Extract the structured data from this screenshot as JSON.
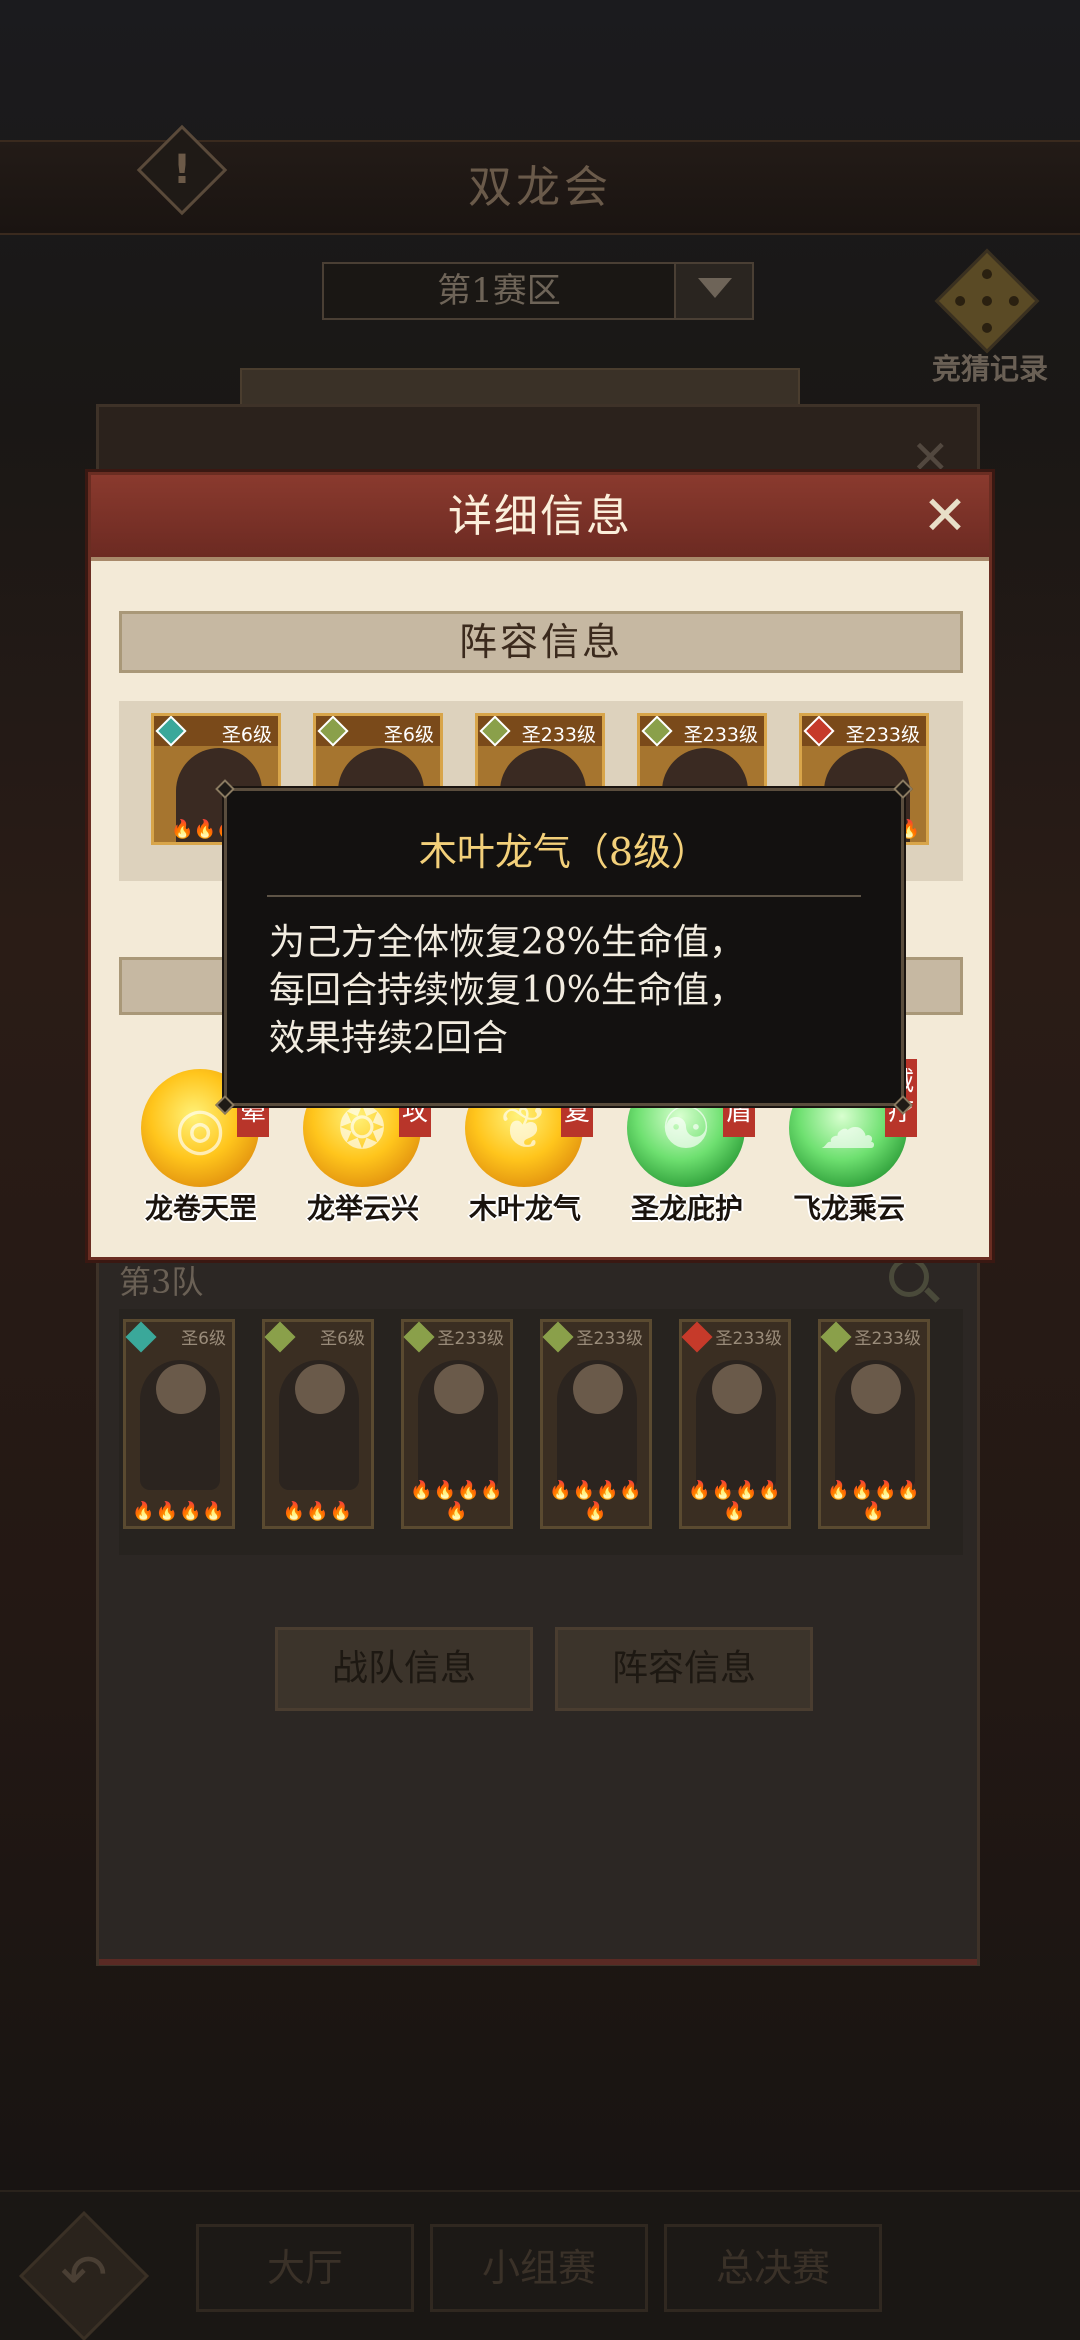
{
  "header": {
    "title": "双龙会",
    "info_icon": "!"
  },
  "zone_select": {
    "value": "第1赛区"
  },
  "bet_record": {
    "label": "竞猜记录"
  },
  "back_panel": {
    "team_label": "第3队",
    "team_heroes": [
      {
        "level": "圣6级",
        "gem_color": "#3aa89a"
      },
      {
        "level": "圣6级",
        "gem_color": "#8aa04a"
      },
      {
        "level": "圣233级",
        "gem_color": "#8aa04a"
      },
      {
        "level": "圣233级",
        "gem_color": "#8aa04a"
      },
      {
        "level": "圣233级",
        "gem_color": "#c63a2a"
      },
      {
        "level": "圣233级",
        "gem_color": "#8aa04a"
      }
    ],
    "buttons": {
      "team_info": "战队信息",
      "lineup_info": "阵容信息"
    }
  },
  "bottom_nav": {
    "tabs": [
      "大厅",
      "小组赛",
      "总决赛"
    ]
  },
  "modal": {
    "title": "详细信息",
    "lineup_heading": "阵容信息",
    "heroes": [
      {
        "level": "圣6级",
        "gem_color": "#3aa89a"
      },
      {
        "level": "圣6级",
        "gem_color": "#8aa04a"
      },
      {
        "level": "圣233级",
        "gem_color": "#8aa04a"
      },
      {
        "level": "圣233级",
        "gem_color": "#8aa04a"
      },
      {
        "level": "圣233级",
        "gem_color": "#c63a2a"
      }
    ],
    "skills": [
      {
        "name": "龙卷天罡",
        "type": "gold",
        "tag": "眩晕"
      },
      {
        "name": "龙举云兴",
        "type": "gold",
        "tag": "防攻"
      },
      {
        "name": "木叶龙气",
        "type": "gold",
        "tag": "恢复"
      },
      {
        "name": "圣龙庇护",
        "type": "green",
        "tag": "护盾"
      },
      {
        "name": "飞龙乘云",
        "type": "green",
        "tag": "减疗"
      }
    ]
  },
  "tooltip": {
    "title": "木叶龙气（8级）",
    "description": "为己方全体恢复28%生命值，\n每回合持续恢复10%生命值，\n效果持续2回合"
  },
  "colors": {
    "modal_header": "#7a3228",
    "modal_body": "#f3ead7",
    "tooltip_title": "#f3d07a",
    "skill_gold": "#ffc51c",
    "skill_green": "#4cc85a",
    "tag_red": "#b8352a"
  }
}
